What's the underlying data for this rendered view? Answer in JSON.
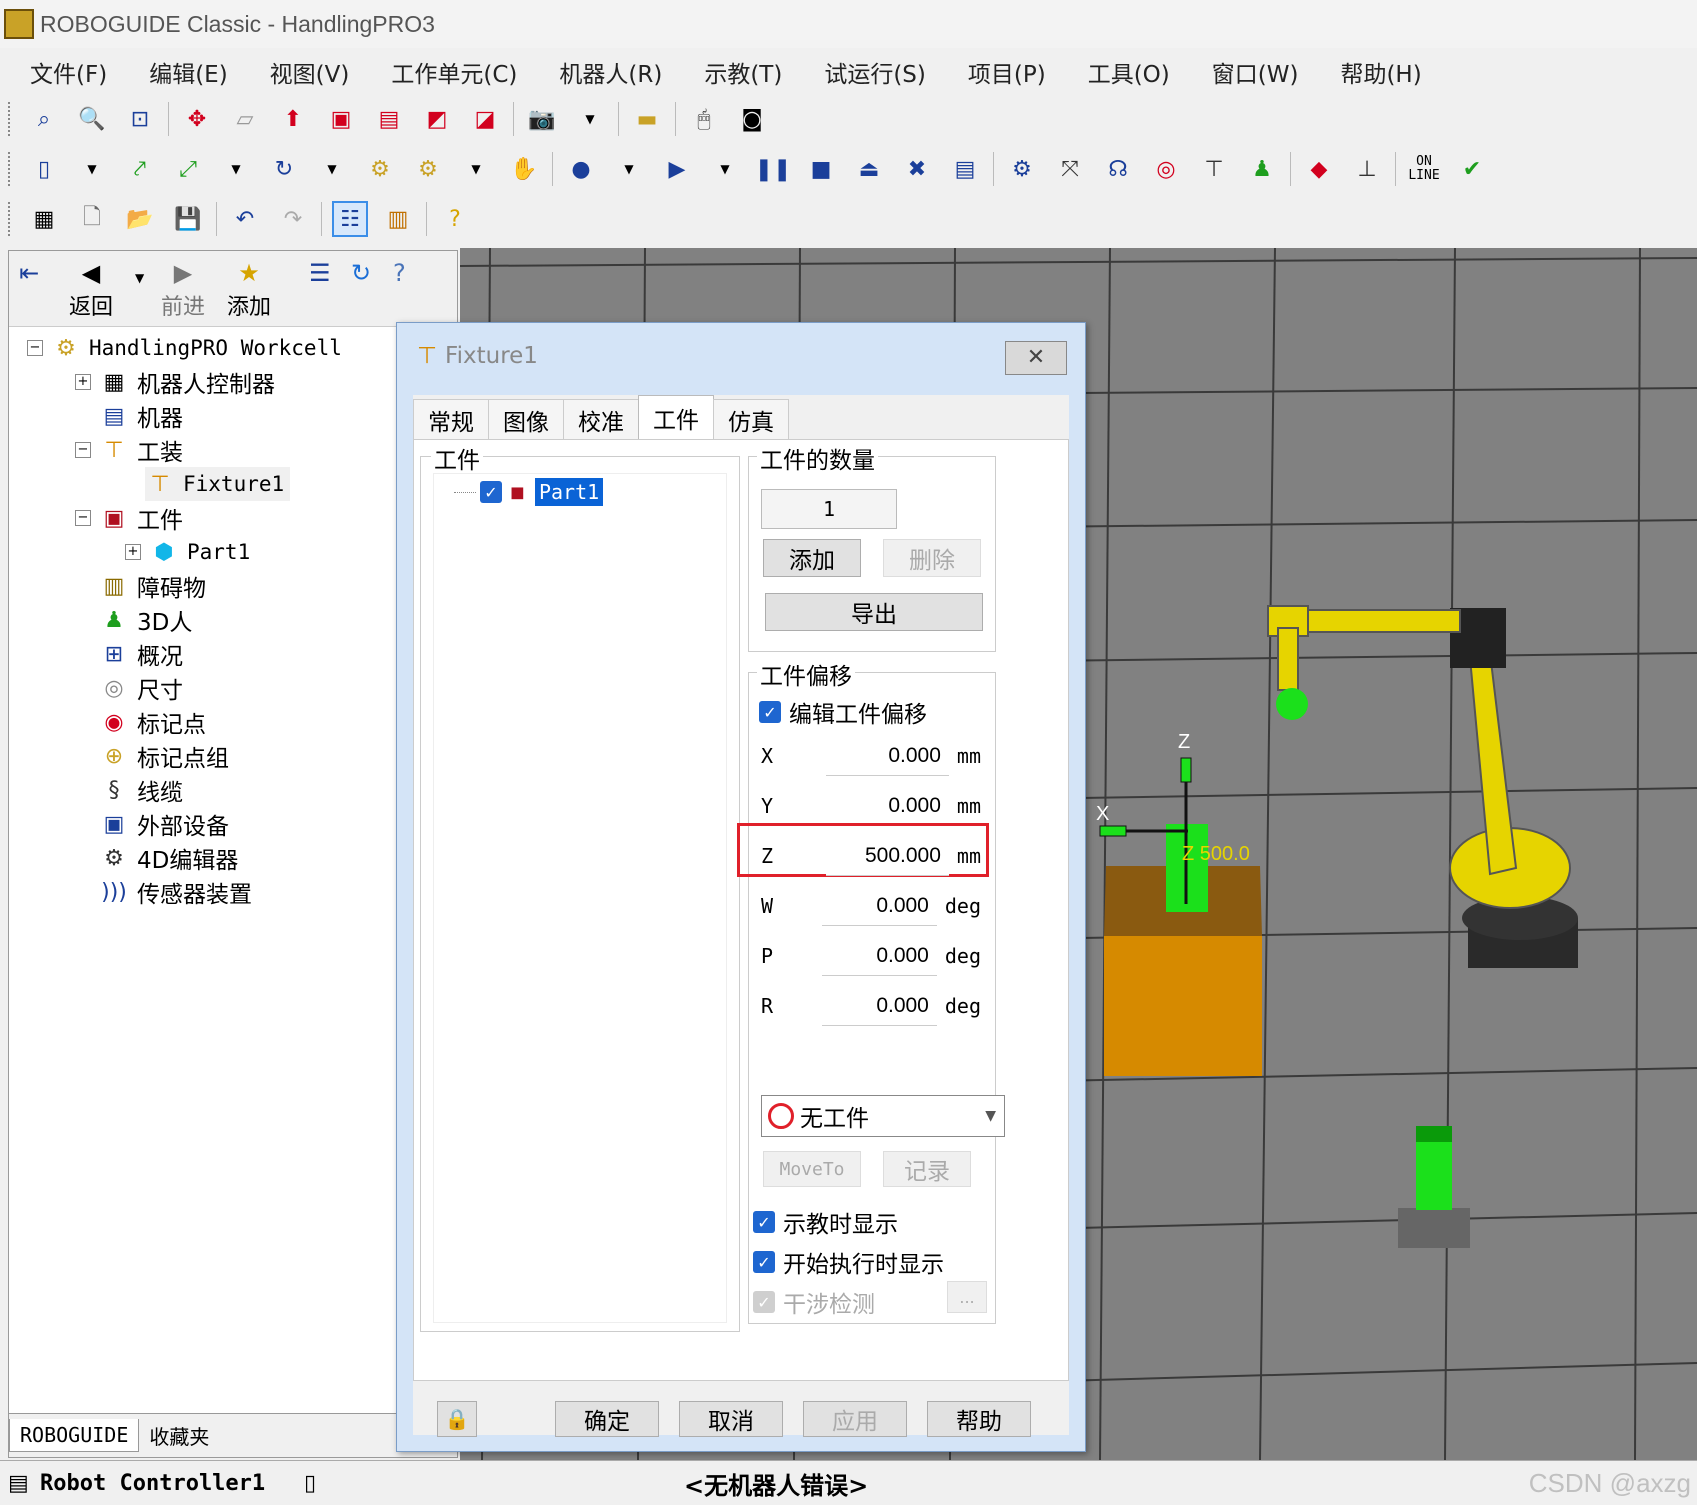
{
  "window": {
    "title": "ROBOGUIDE Classic - HandlingPRO3"
  },
  "menu": [
    "文件(F)",
    "编辑(E)",
    "视图(V)",
    "工作单元(C)",
    "机器人(R)",
    "示教(T)",
    "试运行(S)",
    "项目(P)",
    "工具(O)",
    "窗口(W)",
    "帮助(H)"
  ],
  "toolbar3": {
    "online_line1": "ON",
    "online_line2": "LINE"
  },
  "left_toolbar": {
    "back": "返回",
    "forward": "前进",
    "add": "添加"
  },
  "tree": {
    "root": "HandlingPRO Workcell",
    "items": [
      "机器人控制器",
      "机器",
      "工装",
      "Fixture1",
      "工件",
      "Part1",
      "障碍物",
      "3D人",
      "概况",
      "尺寸",
      "标记点",
      "标记点组",
      "线缆",
      "外部设备",
      "4D编辑器",
      "传感器装置"
    ]
  },
  "left_tabs": [
    "ROBOGUIDE",
    "收藏夹"
  ],
  "dialog": {
    "title": "Fixture1",
    "close": "✕",
    "tabs": [
      "常规",
      "图像",
      "校准",
      "工件",
      "仿真"
    ],
    "parts_group": "工件",
    "part_item": "Part1",
    "count_group": "工件的数量",
    "count_value": "1",
    "add_button": "添加",
    "delete_button": "删除",
    "export_button": "导出",
    "offset_group": "工件偏移",
    "edit_offset": "编辑工件偏移",
    "offsets": [
      {
        "label": "X",
        "value": "0.000",
        "unit": "mm"
      },
      {
        "label": "Y",
        "value": "0.000",
        "unit": "mm"
      },
      {
        "label": "Z",
        "value": "500.000",
        "unit": "mm"
      },
      {
        "label": "W",
        "value": "0.000",
        "unit": "deg"
      },
      {
        "label": "P",
        "value": "0.000",
        "unit": "deg"
      },
      {
        "label": "R",
        "value": "0.000",
        "unit": "deg"
      }
    ],
    "select_value": "无工件",
    "moveto_button": "MoveTo",
    "record_button": "记录",
    "show_teach": "示教时显示",
    "show_run": "开始执行时显示",
    "collision": "干涉检测",
    "ellipsis": "...",
    "ok": "确定",
    "cancel": "取消",
    "apply": "应用",
    "help": "帮助"
  },
  "viewport": {
    "z_label": "Z",
    "x_label": "X",
    "value_label": "Z 500.0"
  },
  "statusbar": {
    "controller": "Robot Controller1",
    "message": "<无机器人错误>",
    "watermark": "CSDN @axzg"
  },
  "colors": {
    "highlight": "#e0202a",
    "selection": "#0a63d6",
    "viewport": "#818181",
    "fixture": "#d68a00",
    "robot": "#e6d400"
  }
}
